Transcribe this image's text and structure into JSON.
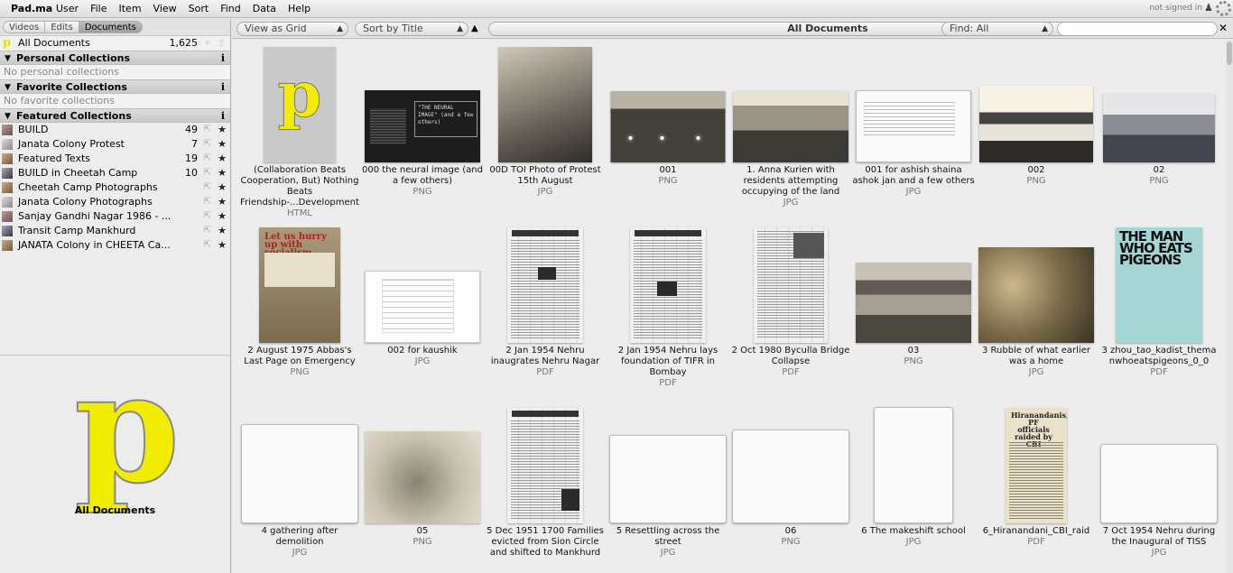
{
  "menubar": {
    "logo": "Pad.ma",
    "menus": [
      "User",
      "File",
      "Item",
      "View",
      "Sort",
      "Find",
      "Data",
      "Help"
    ],
    "status": "not signed in",
    "icons": [
      "user-icon",
      "loading-spinner-icon"
    ]
  },
  "section_tabs": [
    "Videos",
    "Edits",
    "Documents"
  ],
  "active_tab": "Documents",
  "all_documents": {
    "label": "All Documents",
    "count": "1,625"
  },
  "personal": {
    "header": "Personal Collections",
    "empty": "No personal collections"
  },
  "favorite": {
    "header": "Favorite Collections",
    "empty": "No favorite collections"
  },
  "featured": {
    "header": "Featured Collections",
    "items": [
      {
        "label": "BUILD",
        "count": "49"
      },
      {
        "label": "Janata Colony Protest",
        "count": "7"
      },
      {
        "label": "Featured Texts",
        "count": "19"
      },
      {
        "label": "BUILD in Cheetah Camp",
        "count": "10"
      },
      {
        "label": "Cheetah Camp Photographs",
        "count": ""
      },
      {
        "label": "Janata Colony Photographs",
        "count": ""
      },
      {
        "label": "Sanjay Gandhi Nagar 1986 - ...",
        "count": ""
      },
      {
        "label": "Transit Camp Mankhurd",
        "count": ""
      },
      {
        "label": "JANATA Colony in CHEETA Ca...",
        "count": ""
      }
    ]
  },
  "info_panel": {
    "title": "All Documents",
    "logo_letter": "p"
  },
  "toolbar": {
    "view": "View as Grid",
    "sort": "Sort by Title",
    "sort_direction": "▲",
    "title": "All Documents",
    "find": "Find: All",
    "find_value": "",
    "clear": "✕"
  },
  "documents": [
    {
      "title": "(Collaboration Beats Cooperation, But) Nothing Beats Friendship-...Development",
      "type": "HTML",
      "thumb_text": "p"
    },
    {
      "title": "000 the neural image (and a few others)",
      "type": "PNG",
      "thumb_text": "\"THE NEURAL IMAGE\" (and a few others)"
    },
    {
      "title": "00D TOI Photo of Protest 15th August",
      "type": "JPG",
      "thumb_text": ""
    },
    {
      "title": "001",
      "type": "PNG",
      "thumb_text": ""
    },
    {
      "title": "1. Anna Kurien with residents attempting occupying of the land",
      "type": "JPG",
      "thumb_text": ""
    },
    {
      "title": "001 for ashish shaina ashok jan and a few others",
      "type": "JPG",
      "thumb_text": ""
    },
    {
      "title": "002",
      "type": "PNG",
      "thumb_text": ""
    },
    {
      "title": "02",
      "type": "PNG",
      "thumb_text": ""
    },
    {
      "title": "2 August 1975 Abbas's Last Page on Emergency",
      "type": "PNG",
      "thumb_text": "Let us hurry up with socialism"
    },
    {
      "title": "002 for kaushik",
      "type": "JPG",
      "thumb_text": ""
    },
    {
      "title": "2 Jan 1954 Nehru inaugrates Nehru Nagar",
      "type": "PDF",
      "thumb_text": ""
    },
    {
      "title": "2 Jan 1954 Nehru lays foundation of TIFR in Bombay",
      "type": "PDF",
      "thumb_text": ""
    },
    {
      "title": "2 Oct 1980 Byculla Bridge Collapse",
      "type": "PDF",
      "thumb_text": ""
    },
    {
      "title": "03",
      "type": "PNG",
      "thumb_text": ""
    },
    {
      "title": "3 Rubble of what earlier was a home",
      "type": "JPG",
      "thumb_text": ""
    },
    {
      "title": "3 zhou_tao_kadist_thema nwhoeatspigeons_0_0",
      "type": "PDF",
      "thumb_text": "THE MAN WHO EATS PIGEONS"
    },
    {
      "title": "4 gathering after demolition",
      "type": "JPG",
      "thumb_text": ""
    },
    {
      "title": "05",
      "type": "PNG",
      "thumb_text": ""
    },
    {
      "title": "5 Dec 1951 1700 Families evicted from Sion Circle and shifted to Mankhurd",
      "type": "",
      "thumb_text": ""
    },
    {
      "title": "5 Resettling across the street",
      "type": "JPG",
      "thumb_text": ""
    },
    {
      "title": "06",
      "type": "PNG",
      "thumb_text": ""
    },
    {
      "title": "6 The makeshift school",
      "type": "JPG",
      "thumb_text": ""
    },
    {
      "title": "6_Hiranandani_CBI_raid",
      "type": "PDF",
      "thumb_text": "Hiranandanis, PF officials raided by CBI"
    },
    {
      "title": "7 Oct 1954 Nehru during the Inaugural of TISS",
      "type": "JPG",
      "thumb_text": ""
    }
  ]
}
